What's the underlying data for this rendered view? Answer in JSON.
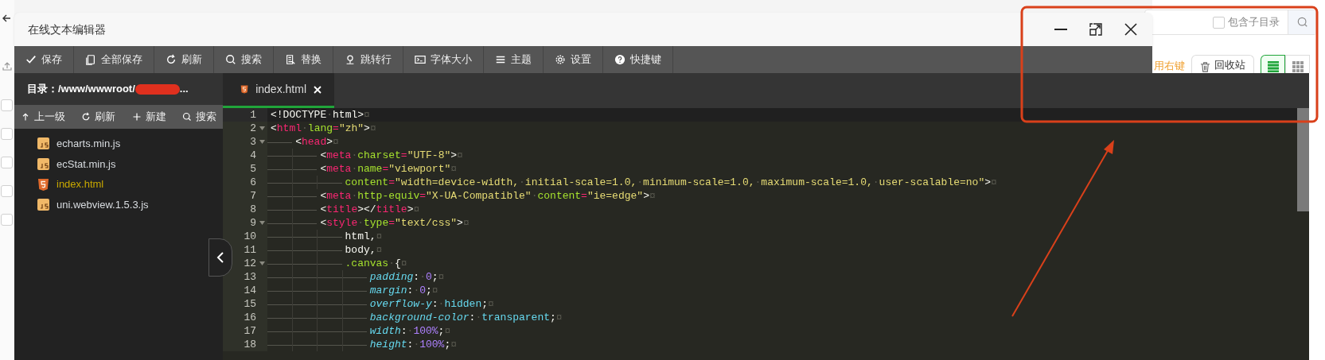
{
  "background_page": {
    "include_subdirs": {
      "label": "包含子目录",
      "checked": false
    },
    "hint": "用右键",
    "recycle_button": "回收站",
    "views": [
      {
        "kind": "list",
        "selected": true
      },
      {
        "kind": "grid",
        "selected": false
      }
    ],
    "row_checkboxes": [
      {
        "checked": false
      },
      {
        "checked": false
      },
      {
        "checked": false
      },
      {
        "checked": false
      },
      {
        "checked": false
      }
    ]
  },
  "window": {
    "title": "在线文本编辑器"
  },
  "toolbar": [
    {
      "kind": "check",
      "label": "保存"
    },
    {
      "kind": "copy",
      "label": "全部保存"
    },
    {
      "kind": "refresh",
      "label": "刷新"
    },
    {
      "kind": "search",
      "label": "搜索"
    },
    {
      "kind": "doc",
      "label": "替换"
    },
    {
      "kind": "pin",
      "label": "跳转行"
    },
    {
      "kind": "terminal",
      "label": "字体大小"
    },
    {
      "kind": "menu",
      "label": "主题"
    },
    {
      "kind": "gear",
      "label": "设置"
    },
    {
      "kind": "help",
      "label": "快捷键"
    }
  ],
  "sidebar": {
    "directory_label": "目录：/www/wwwroot/",
    "directory_trailing": "...",
    "actions": [
      {
        "kind": "up",
        "label": "上一级"
      },
      {
        "kind": "refresh",
        "label": "刷新"
      },
      {
        "kind": "plus",
        "label": "新建"
      },
      {
        "kind": "search",
        "label": "搜索"
      }
    ],
    "files": [
      {
        "kind": "js",
        "name": "echarts.min.js",
        "selected": false
      },
      {
        "kind": "js",
        "name": "ecStat.min.js",
        "selected": false
      },
      {
        "kind": "html",
        "name": "index.html",
        "selected": true
      },
      {
        "kind": "js",
        "name": "uni.webview.1.5.3.js",
        "selected": false
      }
    ]
  },
  "tabs": [
    {
      "kind": "html",
      "label": "index.html",
      "selected": true
    }
  ],
  "editor": {
    "lines": [
      {
        "number": "1",
        "fold": false,
        "active": true,
        "tokens": [
          {
            "kind": "p",
            "text": "<!DOCTYPE"
          },
          {
            "kind": "ws",
            "text": "·"
          },
          {
            "kind": "p",
            "text": "html>"
          },
          {
            "kind": "eol",
            "text": "¤"
          }
        ]
      },
      {
        "number": "2",
        "fold": true,
        "active": false,
        "tokens": [
          {
            "kind": "p",
            "text": "<"
          },
          {
            "kind": "tag",
            "text": "html"
          },
          {
            "kind": "ws",
            "text": "·"
          },
          {
            "kind": "attr",
            "text": "lang"
          },
          {
            "kind": "op",
            "text": "="
          },
          {
            "kind": "str",
            "text": "\"zh\""
          },
          {
            "kind": "p",
            "text": ">"
          },
          {
            "kind": "eol",
            "text": "¤"
          }
        ],
        "children": [
          {
            "number": "3",
            "fold": true,
            "active": false,
            "tokens": [
              {
                "kind": "p",
                "text": "<"
              },
              {
                "kind": "tag",
                "text": "head"
              },
              {
                "kind": "p",
                "text": ">"
              },
              {
                "kind": "eol",
                "text": "¤"
              }
            ],
            "children": [
              {
                "number": "4",
                "fold": false,
                "active": false,
                "tokens": [
                  {
                    "kind": "p",
                    "text": "<"
                  },
                  {
                    "kind": "tag",
                    "text": "meta"
                  },
                  {
                    "kind": "ws",
                    "text": "·"
                  },
                  {
                    "kind": "attr",
                    "text": "charset"
                  },
                  {
                    "kind": "op",
                    "text": "="
                  },
                  {
                    "kind": "str",
                    "text": "\"UTF-8\""
                  },
                  {
                    "kind": "p",
                    "text": ">"
                  },
                  {
                    "kind": "eol",
                    "text": "¤"
                  }
                ]
              },
              {
                "number": "5",
                "fold": false,
                "active": false,
                "tokens": [
                  {
                    "kind": "p",
                    "text": "<"
                  },
                  {
                    "kind": "tag",
                    "text": "meta"
                  },
                  {
                    "kind": "ws",
                    "text": "·"
                  },
                  {
                    "kind": "attr",
                    "text": "name"
                  },
                  {
                    "kind": "op",
                    "text": "="
                  },
                  {
                    "kind": "str",
                    "text": "\"viewport\""
                  },
                  {
                    "kind": "eol",
                    "text": "¤"
                  }
                ],
                "children": [
                  {
                    "number": "6",
                    "fold": false,
                    "active": false,
                    "tokens": [
                      {
                        "kind": "attr",
                        "text": "content"
                      },
                      {
                        "kind": "op",
                        "text": "="
                      },
                      {
                        "kind": "str",
                        "text": "\"width=device-width,"
                      },
                      {
                        "kind": "ws",
                        "text": "·"
                      },
                      {
                        "kind": "str",
                        "text": "initial-scale=1.0,"
                      },
                      {
                        "kind": "ws",
                        "text": "·"
                      },
                      {
                        "kind": "str",
                        "text": "minimum-scale=1.0,"
                      },
                      {
                        "kind": "ws",
                        "text": "·"
                      },
                      {
                        "kind": "str",
                        "text": "maximum-scale=1.0,"
                      },
                      {
                        "kind": "ws",
                        "text": "·"
                      },
                      {
                        "kind": "str",
                        "text": "user-scalable=no\""
                      },
                      {
                        "kind": "p",
                        "text": ">"
                      },
                      {
                        "kind": "eol",
                        "text": "¤"
                      }
                    ]
                  }
                ]
              },
              {
                "number": "7",
                "fold": false,
                "active": false,
                "tokens": [
                  {
                    "kind": "p",
                    "text": "<"
                  },
                  {
                    "kind": "tag",
                    "text": "meta"
                  },
                  {
                    "kind": "ws",
                    "text": "·"
                  },
                  {
                    "kind": "attr",
                    "text": "http-equiv"
                  },
                  {
                    "kind": "op",
                    "text": "="
                  },
                  {
                    "kind": "str",
                    "text": "\"X-UA-Compatible\""
                  },
                  {
                    "kind": "ws",
                    "text": "·"
                  },
                  {
                    "kind": "attr",
                    "text": "content"
                  },
                  {
                    "kind": "op",
                    "text": "="
                  },
                  {
                    "kind": "str",
                    "text": "\"ie=edge\""
                  },
                  {
                    "kind": "p",
                    "text": ">"
                  },
                  {
                    "kind": "eol",
                    "text": "¤"
                  }
                ]
              },
              {
                "number": "8",
                "fold": false,
                "active": false,
                "tokens": [
                  {
                    "kind": "p",
                    "text": "<"
                  },
                  {
                    "kind": "tag",
                    "text": "title"
                  },
                  {
                    "kind": "p",
                    "text": "></"
                  },
                  {
                    "kind": "tag",
                    "text": "title"
                  },
                  {
                    "kind": "p",
                    "text": ">"
                  },
                  {
                    "kind": "eol",
                    "text": "¤"
                  }
                ]
              },
              {
                "number": "9",
                "fold": true,
                "active": false,
                "tokens": [
                  {
                    "kind": "p",
                    "text": "<"
                  },
                  {
                    "kind": "tag",
                    "text": "style"
                  },
                  {
                    "kind": "ws",
                    "text": "·"
                  },
                  {
                    "kind": "attr",
                    "text": "type"
                  },
                  {
                    "kind": "op",
                    "text": "="
                  },
                  {
                    "kind": "str",
                    "text": "\"text/css\""
                  },
                  {
                    "kind": "p",
                    "text": ">"
                  },
                  {
                    "kind": "eol",
                    "text": "¤"
                  }
                ],
                "children": [
                  {
                    "number": "10",
                    "fold": false,
                    "active": false,
                    "tokens": [
                      {
                        "kind": "p",
                        "text": "html,"
                      },
                      {
                        "kind": "eol",
                        "text": "¤"
                      }
                    ]
                  },
                  {
                    "number": "11",
                    "fold": false,
                    "active": false,
                    "tokens": [
                      {
                        "kind": "p",
                        "text": "body,"
                      },
                      {
                        "kind": "eol",
                        "text": "¤"
                      }
                    ]
                  },
                  {
                    "number": "12",
                    "fold": true,
                    "active": false,
                    "tokens": [
                      {
                        "kind": "attr",
                        "text": ".canvas"
                      },
                      {
                        "kind": "ws",
                        "text": "·"
                      },
                      {
                        "kind": "p",
                        "text": "{"
                      },
                      {
                        "kind": "eol",
                        "text": "¤"
                      }
                    ],
                    "children": [
                      {
                        "number": "13",
                        "fold": false,
                        "active": false,
                        "tokens": [
                          {
                            "kind": "prop",
                            "text": "padding"
                          },
                          {
                            "kind": "p",
                            "text": ":"
                          },
                          {
                            "kind": "ws",
                            "text": "·"
                          },
                          {
                            "kind": "num",
                            "text": "0"
                          },
                          {
                            "kind": "p",
                            "text": ";"
                          },
                          {
                            "kind": "eol",
                            "text": "¤"
                          }
                        ]
                      },
                      {
                        "number": "14",
                        "fold": false,
                        "active": false,
                        "tokens": [
                          {
                            "kind": "prop",
                            "text": "margin"
                          },
                          {
                            "kind": "p",
                            "text": ":"
                          },
                          {
                            "kind": "ws",
                            "text": "·"
                          },
                          {
                            "kind": "num",
                            "text": "0"
                          },
                          {
                            "kind": "p",
                            "text": ";"
                          },
                          {
                            "kind": "eol",
                            "text": "¤"
                          }
                        ]
                      },
                      {
                        "number": "15",
                        "fold": false,
                        "active": false,
                        "tokens": [
                          {
                            "kind": "prop",
                            "text": "overflow-y"
                          },
                          {
                            "kind": "p",
                            "text": ":"
                          },
                          {
                            "kind": "ws",
                            "text": "·"
                          },
                          {
                            "kind": "val",
                            "text": "hidden"
                          },
                          {
                            "kind": "p",
                            "text": ";"
                          },
                          {
                            "kind": "eol",
                            "text": "¤"
                          }
                        ]
                      },
                      {
                        "number": "16",
                        "fold": false,
                        "active": false,
                        "tokens": [
                          {
                            "kind": "prop",
                            "text": "background-color"
                          },
                          {
                            "kind": "p",
                            "text": ":"
                          },
                          {
                            "kind": "ws",
                            "text": "·"
                          },
                          {
                            "kind": "val",
                            "text": "transparent"
                          },
                          {
                            "kind": "p",
                            "text": ";"
                          },
                          {
                            "kind": "eol",
                            "text": "¤"
                          }
                        ]
                      },
                      {
                        "number": "17",
                        "fold": false,
                        "active": false,
                        "tokens": [
                          {
                            "kind": "prop",
                            "text": "width"
                          },
                          {
                            "kind": "p",
                            "text": ":"
                          },
                          {
                            "kind": "ws",
                            "text": "·"
                          },
                          {
                            "kind": "num",
                            "text": "100%"
                          },
                          {
                            "kind": "p",
                            "text": ";"
                          },
                          {
                            "kind": "eol",
                            "text": "¤"
                          }
                        ]
                      },
                      {
                        "number": "18",
                        "fold": false,
                        "active": false,
                        "tokens": [
                          {
                            "kind": "prop",
                            "text": "height"
                          },
                          {
                            "kind": "p",
                            "text": ":"
                          },
                          {
                            "kind": "ws",
                            "text": "·"
                          },
                          {
                            "kind": "num",
                            "text": "100%"
                          },
                          {
                            "kind": "p",
                            "text": ";"
                          },
                          {
                            "kind": "eol",
                            "text": "¤"
                          }
                        ]
                      }
                    ]
                  }
                ]
              }
            ]
          }
        ]
      }
    ]
  }
}
